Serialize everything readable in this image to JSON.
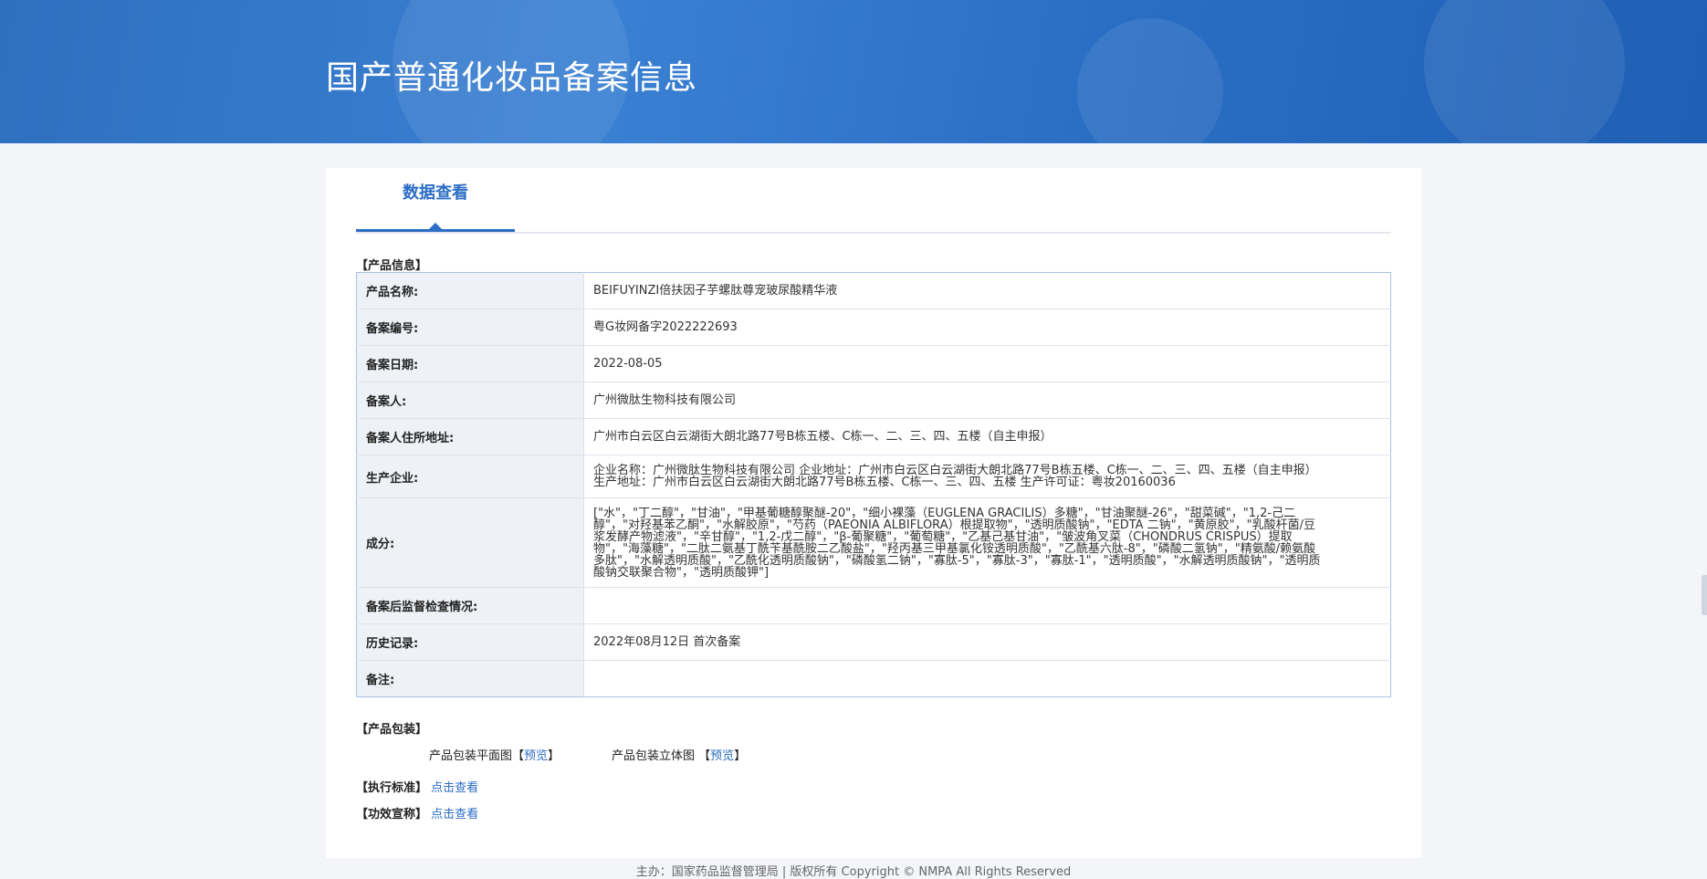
{
  "header": {
    "title": "国产普通化妆品备案信息"
  },
  "tabs": [
    {
      "label": "数据查看",
      "active": true
    }
  ],
  "product_info": {
    "section_title": "【产品信息】",
    "rows": [
      {
        "key": "产品名称:",
        "value": "BEIFUYINZI倍扶因子芋螺肽尊宠玻尿酸精华液"
      },
      {
        "key": "备案编号:",
        "value": "粤G妆网备字2022222693"
      },
      {
        "key": "备案日期:",
        "value": "2022-08-05"
      },
      {
        "key": "备案人:",
        "value": "广州微肽生物科技有限公司"
      },
      {
        "key": "备案人住所地址:",
        "value": "广州市白云区白云湖街大朗北路77号B栋五楼、C栋一、二、三、四、五楼（自主申报）"
      },
      {
        "key": "生产企业:",
        "value_lines": [
          "企业名称：广州微肽生物科技有限公司 企业地址：广州市白云区白云湖街大朗北路77号B栋五楼、C栋一、二、三、四、五楼（自主申报）",
          "生产地址：广州市白云区白云湖街大朗北路77号B栋五楼、C栋一、三、四、五楼 生产许可证：粤妆20160036"
        ]
      },
      {
        "key": "成分:",
        "value_lines": [
          "[\"水\"，\"丁二醇\"，\"甘油\"，\"甲基葡糖醇聚醚-20\"，\"细小裸藻（EUGLENA GRACILIS）多糖\"，\"甘油聚醚-26\"，\"甜菜碱\"，\"1,2-己二",
          "醇\"，\"对羟基苯乙酮\"，\"水解胶原\"，\"芍药（PAEONIA ALBIFLORA）根提取物\"，\"透明质酸钠\"，\"EDTA 二钠\"，\"黄原胶\"，\"乳酸杆菌/豆",
          "浆发酵产物滤液\"，\"辛甘醇\"，\"1,2-戊二醇\"，\"β-葡聚糖\"，\"葡萄糖\"，\"乙基己基甘油\"，\"皱波角叉菜（CHONDRUS CRISPUS）提取",
          "物\"，\"海藻糖\"，\"二肽二氨基丁酰苄基酰胺二乙酸盐\"，\"羟丙基三甲基氯化铵透明质酸\"，\"乙酰基六肽-8\"，\"磷酸二氢钠\"，\"精氨酸/赖氨酸",
          "多肽\"，\"水解透明质酸\"，\"乙酰化透明质酸钠\"，\"磷酸氢二钠\"，\"寡肽-5\"，\"寡肽-3\"，\"寡肽-1\"，\"透明质酸\"，\"水解透明质酸钠\"，\"透明质",
          "酸钠交联聚合物\"，\"透明质酸钾\"]"
        ]
      },
      {
        "key": "备案后监督检查情况:",
        "value": ""
      },
      {
        "key": "历史记录:",
        "value": "2022年08月12日 首次备案"
      },
      {
        "key": "备注:",
        "value": ""
      }
    ]
  },
  "packaging": {
    "section_title": "【产品包装】",
    "flat_label": "产品包装平面图",
    "solid_label": "产品包装立体图",
    "preview_open": "【",
    "preview_text": "预览",
    "preview_close": "】"
  },
  "standards": {
    "exec_label": "【执行标准】",
    "exec_link": "点击查看",
    "efficacy_label": "【功效宣称】",
    "efficacy_link": "点击查看"
  },
  "footer": {
    "text": "主办：国家药品监督管理局 | 版权所有 Copyright © NMPA All Rights Reserved"
  },
  "colors": {
    "accent": "#2b6cc4",
    "banner": "#2f6fc0",
    "label_bg": "#eef1f5",
    "table_border": "#a9c1e2"
  }
}
